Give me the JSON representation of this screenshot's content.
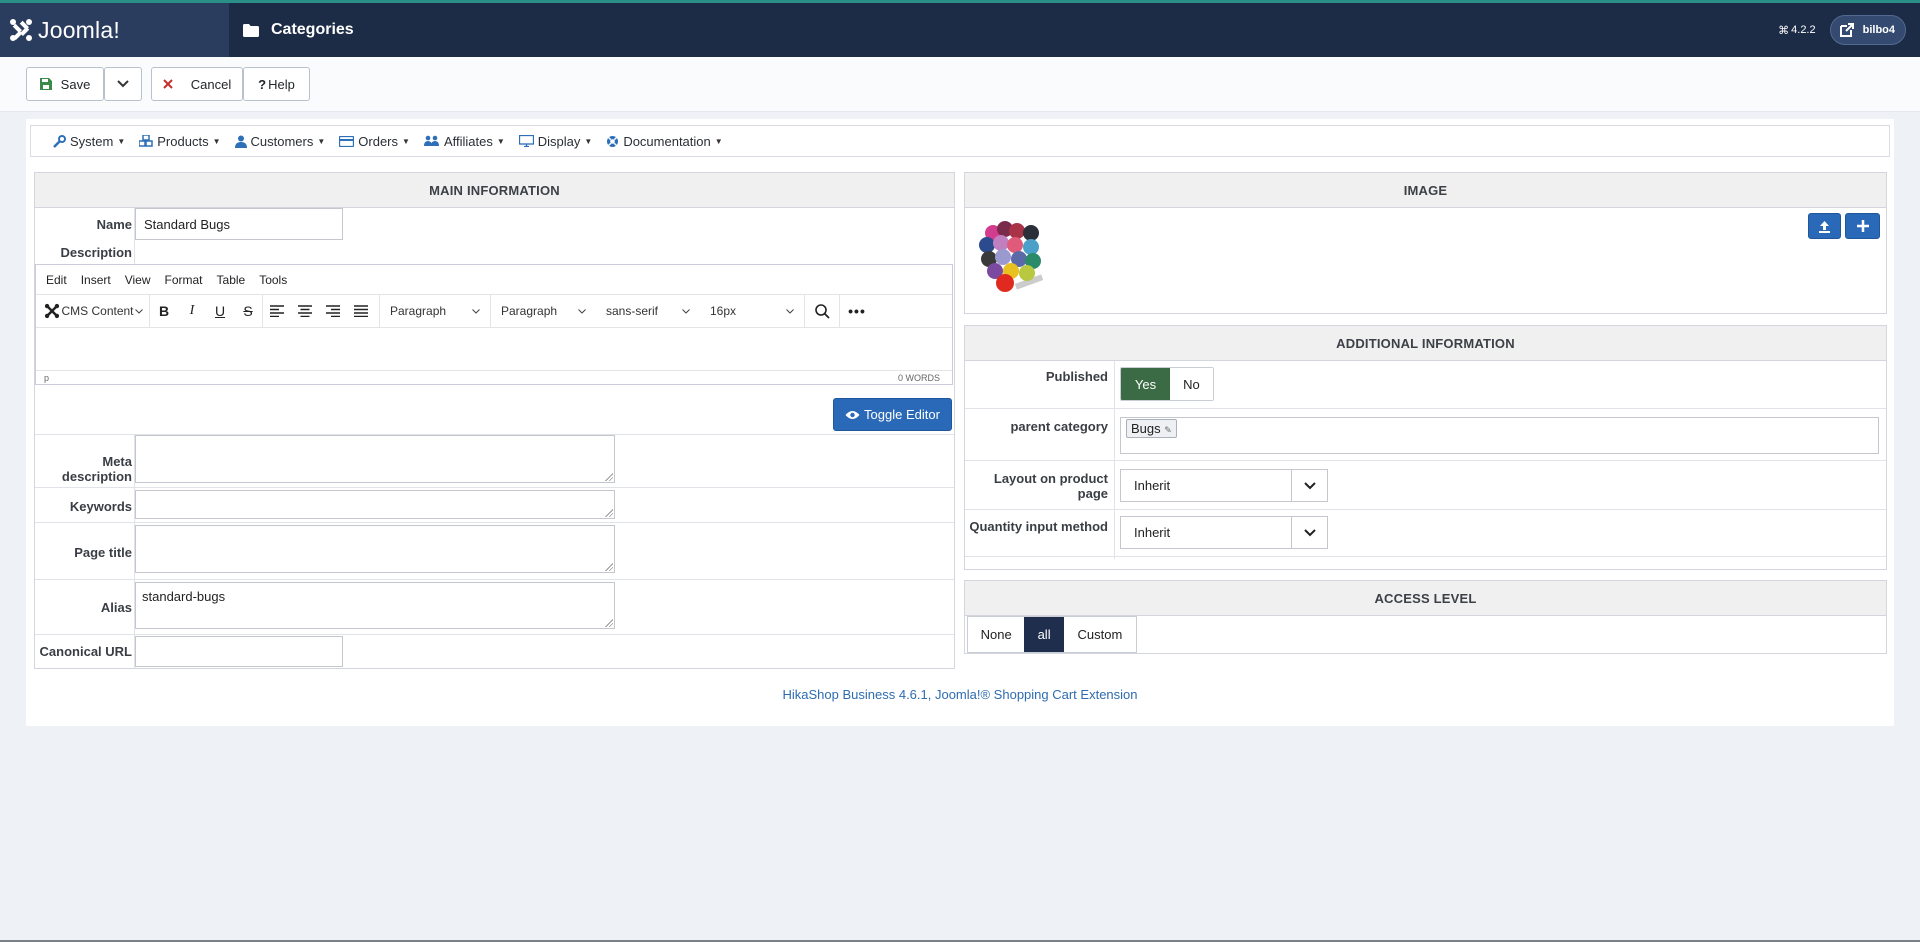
{
  "header": {
    "logo_text": "Joomla!",
    "page_title": "Categories",
    "version": "4.2.2",
    "user_label": "bilbo4"
  },
  "toolbar": {
    "save_label": "Save",
    "cancel_label": "Cancel",
    "help_label": "Help"
  },
  "menu": {
    "items": [
      "System",
      "Products",
      "Customers",
      "Orders",
      "Affiliates",
      "Display",
      "Documentation"
    ]
  },
  "main_info": {
    "heading": "MAIN INFORMATION",
    "name_label": "Name",
    "name_value": "Standard Bugs",
    "description_label": "Description",
    "editor": {
      "menu": [
        "Edit",
        "Insert",
        "View",
        "Format",
        "Table",
        "Tools"
      ],
      "cms_content": "CMS Content",
      "block1": "Paragraph",
      "block2": "Paragraph",
      "font": "sans-serif",
      "size": "16px",
      "path": "p",
      "words": "0 WORDS"
    },
    "toggle_editor_label": "Toggle Editor",
    "meta_description_label": "Meta description",
    "keywords_label": "Keywords",
    "page_title_label": "Page title",
    "alias_label": "Alias",
    "alias_value": "standard-bugs",
    "canonical_url_label": "Canonical URL"
  },
  "image_section": {
    "heading": "IMAGE"
  },
  "additional": {
    "heading": "ADDITIONAL INFORMATION",
    "published_label": "Published",
    "yes_label": "Yes",
    "no_label": "No",
    "published_value": "Yes",
    "parent_category_label": "parent category",
    "parent_category_value": "Bugs",
    "layout_label": "Layout on product page",
    "layout_value": "Inherit",
    "quantity_label": "Quantity input method",
    "quantity_value": "Inherit"
  },
  "access": {
    "heading": "ACCESS LEVEL",
    "options": [
      "None",
      "all",
      "Custom"
    ],
    "selected": "all"
  },
  "footer": {
    "text": "HikaShop Business 4.6.1, Joomla!® Shopping Cart Extension"
  },
  "colors": {
    "header_bg": "#1c2b46",
    "accent_blue": "#2a69b8",
    "published_yes": "#3b6b45",
    "access_selected": "#1f2e4c"
  }
}
